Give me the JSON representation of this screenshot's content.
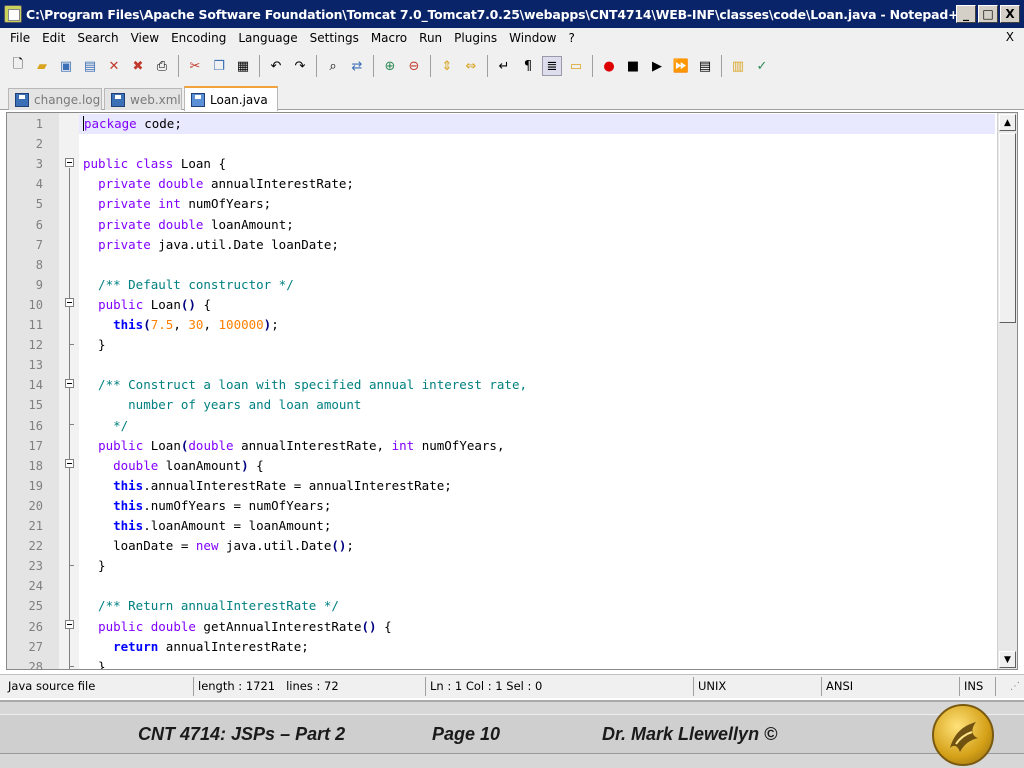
{
  "window": {
    "title": "C:\\Program Files\\Apache Software Foundation\\Tomcat 7.0_Tomcat7.0.25\\webapps\\CNT4714\\WEB-INF\\classes\\code\\Loan.java - Notepad++",
    "buttons": [
      "_",
      "□",
      "X"
    ]
  },
  "menubar": {
    "items": [
      "File",
      "Edit",
      "Search",
      "View",
      "Encoding",
      "Language",
      "Settings",
      "Macro",
      "Run",
      "Plugins",
      "Window",
      "?"
    ],
    "close": "X"
  },
  "toolbar": {
    "icons": [
      "new-file-icon",
      "open-file-icon",
      "save-icon",
      "save-all-icon",
      "close-icon",
      "close-all-icon",
      "print-icon",
      "cut-icon",
      "copy-icon",
      "paste-icon",
      "undo-icon",
      "redo-icon",
      "find-icon",
      "replace-icon",
      "zoom-in-icon",
      "zoom-out-icon",
      "sync-v-icon",
      "sync-h-icon",
      "word-wrap-icon",
      "show-all-chars-icon",
      "indent-guide-icon",
      "language-icon",
      "record-macro-icon",
      "stop-macro-icon",
      "play-macro-icon",
      "run-macro-multiple-icon",
      "save-macro-icon",
      "function-list-icon",
      "spell-check-icon"
    ]
  },
  "tabs": [
    {
      "label": "change.log",
      "active": false
    },
    {
      "label": "web.xml",
      "active": false
    },
    {
      "label": "Loan.java",
      "active": true
    }
  ],
  "editor": {
    "line_numbers": [
      "1",
      "2",
      "3",
      "4",
      "5",
      "6",
      "7",
      "8",
      "9",
      "10",
      "11",
      "12",
      "13",
      "14",
      "15",
      "16",
      "17",
      "18",
      "19",
      "20",
      "21",
      "22",
      "23",
      "24",
      "25",
      "26",
      "27",
      "28"
    ],
    "lines": [
      "package code;",
      "",
      "public class Loan {",
      "  private double annualInterestRate;",
      "  private int numOfYears;",
      "  private double loanAmount;",
      "  private java.util.Date loanDate;",
      "",
      "  /** Default constructor */",
      "  public Loan() {",
      "    this(7.5, 30, 100000);",
      "  }",
      "",
      "  /** Construct a loan with specified annual interest rate,",
      "      number of years and loan amount",
      "    */",
      "  public Loan(double annualInterestRate, int numOfYears,",
      "    double loanAmount) {",
      "    this.annualInterestRate = annualInterestRate;",
      "    this.numOfYears = numOfYears;",
      "    this.loanAmount = loanAmount;",
      "    loanDate = new java.util.Date();",
      "  }",
      "",
      "  /** Return annualInterestRate */",
      "  public double getAnnualInterestRate() {",
      "    return annualInterestRate;",
      "  }"
    ]
  },
  "status": {
    "file_type": "Java source file",
    "length": "length : 1721",
    "lines": "lines : 72",
    "position": "Ln : 1    Col : 1    Sel : 0",
    "eol": "UNIX",
    "encoding": "ANSI",
    "mode": "INS"
  },
  "footer": {
    "course": "CNT 4714: JSPs – Part 2",
    "page": "Page 10",
    "author": "Dr. Mark Llewellyn ©"
  }
}
